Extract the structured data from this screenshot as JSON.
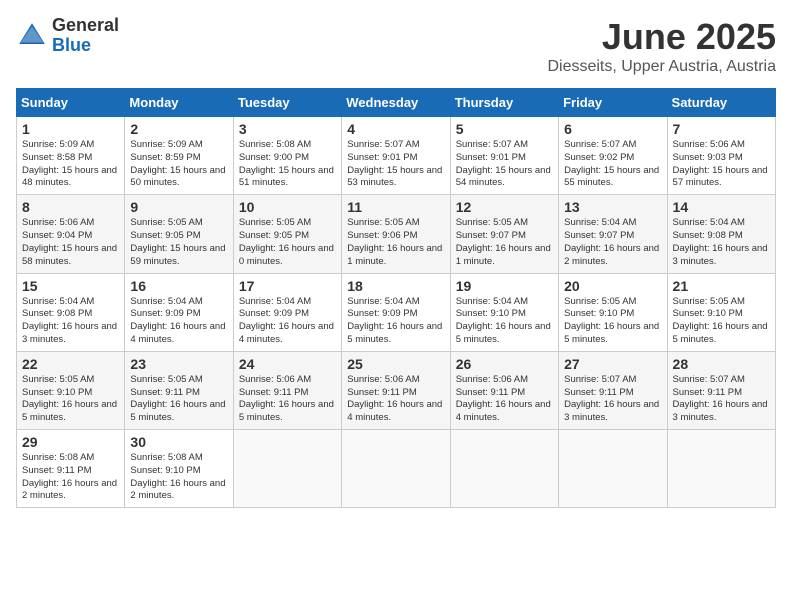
{
  "header": {
    "logo_general": "General",
    "logo_blue": "Blue",
    "title": "June 2025",
    "subtitle": "Diesseits, Upper Austria, Austria"
  },
  "calendar": {
    "days_of_week": [
      "Sunday",
      "Monday",
      "Tuesday",
      "Wednesday",
      "Thursday",
      "Friday",
      "Saturday"
    ],
    "weeks": [
      [
        null,
        null,
        null,
        null,
        null,
        null,
        null
      ]
    ],
    "cells": {
      "1": {
        "day": "1",
        "sunrise": "5:09 AM",
        "sunset": "8:58 PM",
        "daylight": "15 hours and 48 minutes."
      },
      "2": {
        "day": "2",
        "sunrise": "5:09 AM",
        "sunset": "8:59 PM",
        "daylight": "15 hours and 50 minutes."
      },
      "3": {
        "day": "3",
        "sunrise": "5:08 AM",
        "sunset": "9:00 PM",
        "daylight": "15 hours and 51 minutes."
      },
      "4": {
        "day": "4",
        "sunrise": "5:07 AM",
        "sunset": "9:01 PM",
        "daylight": "15 hours and 53 minutes."
      },
      "5": {
        "day": "5",
        "sunrise": "5:07 AM",
        "sunset": "9:01 PM",
        "daylight": "15 hours and 54 minutes."
      },
      "6": {
        "day": "6",
        "sunrise": "5:07 AM",
        "sunset": "9:02 PM",
        "daylight": "15 hours and 55 minutes."
      },
      "7": {
        "day": "7",
        "sunrise": "5:06 AM",
        "sunset": "9:03 PM",
        "daylight": "15 hours and 57 minutes."
      },
      "8": {
        "day": "8",
        "sunrise": "5:06 AM",
        "sunset": "9:04 PM",
        "daylight": "15 hours and 58 minutes."
      },
      "9": {
        "day": "9",
        "sunrise": "5:05 AM",
        "sunset": "9:05 PM",
        "daylight": "15 hours and 59 minutes."
      },
      "10": {
        "day": "10",
        "sunrise": "5:05 AM",
        "sunset": "9:05 PM",
        "daylight": "16 hours and 0 minutes."
      },
      "11": {
        "day": "11",
        "sunrise": "5:05 AM",
        "sunset": "9:06 PM",
        "daylight": "16 hours and 1 minute."
      },
      "12": {
        "day": "12",
        "sunrise": "5:05 AM",
        "sunset": "9:07 PM",
        "daylight": "16 hours and 1 minute."
      },
      "13": {
        "day": "13",
        "sunrise": "5:04 AM",
        "sunset": "9:07 PM",
        "daylight": "16 hours and 2 minutes."
      },
      "14": {
        "day": "14",
        "sunrise": "5:04 AM",
        "sunset": "9:08 PM",
        "daylight": "16 hours and 3 minutes."
      },
      "15": {
        "day": "15",
        "sunrise": "5:04 AM",
        "sunset": "9:08 PM",
        "daylight": "16 hours and 3 minutes."
      },
      "16": {
        "day": "16",
        "sunrise": "5:04 AM",
        "sunset": "9:09 PM",
        "daylight": "16 hours and 4 minutes."
      },
      "17": {
        "day": "17",
        "sunrise": "5:04 AM",
        "sunset": "9:09 PM",
        "daylight": "16 hours and 4 minutes."
      },
      "18": {
        "day": "18",
        "sunrise": "5:04 AM",
        "sunset": "9:09 PM",
        "daylight": "16 hours and 5 minutes."
      },
      "19": {
        "day": "19",
        "sunrise": "5:04 AM",
        "sunset": "9:10 PM",
        "daylight": "16 hours and 5 minutes."
      },
      "20": {
        "day": "20",
        "sunrise": "5:05 AM",
        "sunset": "9:10 PM",
        "daylight": "16 hours and 5 minutes."
      },
      "21": {
        "day": "21",
        "sunrise": "5:05 AM",
        "sunset": "9:10 PM",
        "daylight": "16 hours and 5 minutes."
      },
      "22": {
        "day": "22",
        "sunrise": "5:05 AM",
        "sunset": "9:10 PM",
        "daylight": "16 hours and 5 minutes."
      },
      "23": {
        "day": "23",
        "sunrise": "5:05 AM",
        "sunset": "9:11 PM",
        "daylight": "16 hours and 5 minutes."
      },
      "24": {
        "day": "24",
        "sunrise": "5:06 AM",
        "sunset": "9:11 PM",
        "daylight": "16 hours and 5 minutes."
      },
      "25": {
        "day": "25",
        "sunrise": "5:06 AM",
        "sunset": "9:11 PM",
        "daylight": "16 hours and 4 minutes."
      },
      "26": {
        "day": "26",
        "sunrise": "5:06 AM",
        "sunset": "9:11 PM",
        "daylight": "16 hours and 4 minutes."
      },
      "27": {
        "day": "27",
        "sunrise": "5:07 AM",
        "sunset": "9:11 PM",
        "daylight": "16 hours and 3 minutes."
      },
      "28": {
        "day": "28",
        "sunrise": "5:07 AM",
        "sunset": "9:11 PM",
        "daylight": "16 hours and 3 minutes."
      },
      "29": {
        "day": "29",
        "sunrise": "5:08 AM",
        "sunset": "9:11 PM",
        "daylight": "16 hours and 2 minutes."
      },
      "30": {
        "day": "30",
        "sunrise": "5:08 AM",
        "sunset": "9:10 PM",
        "daylight": "16 hours and 2 minutes."
      }
    }
  }
}
